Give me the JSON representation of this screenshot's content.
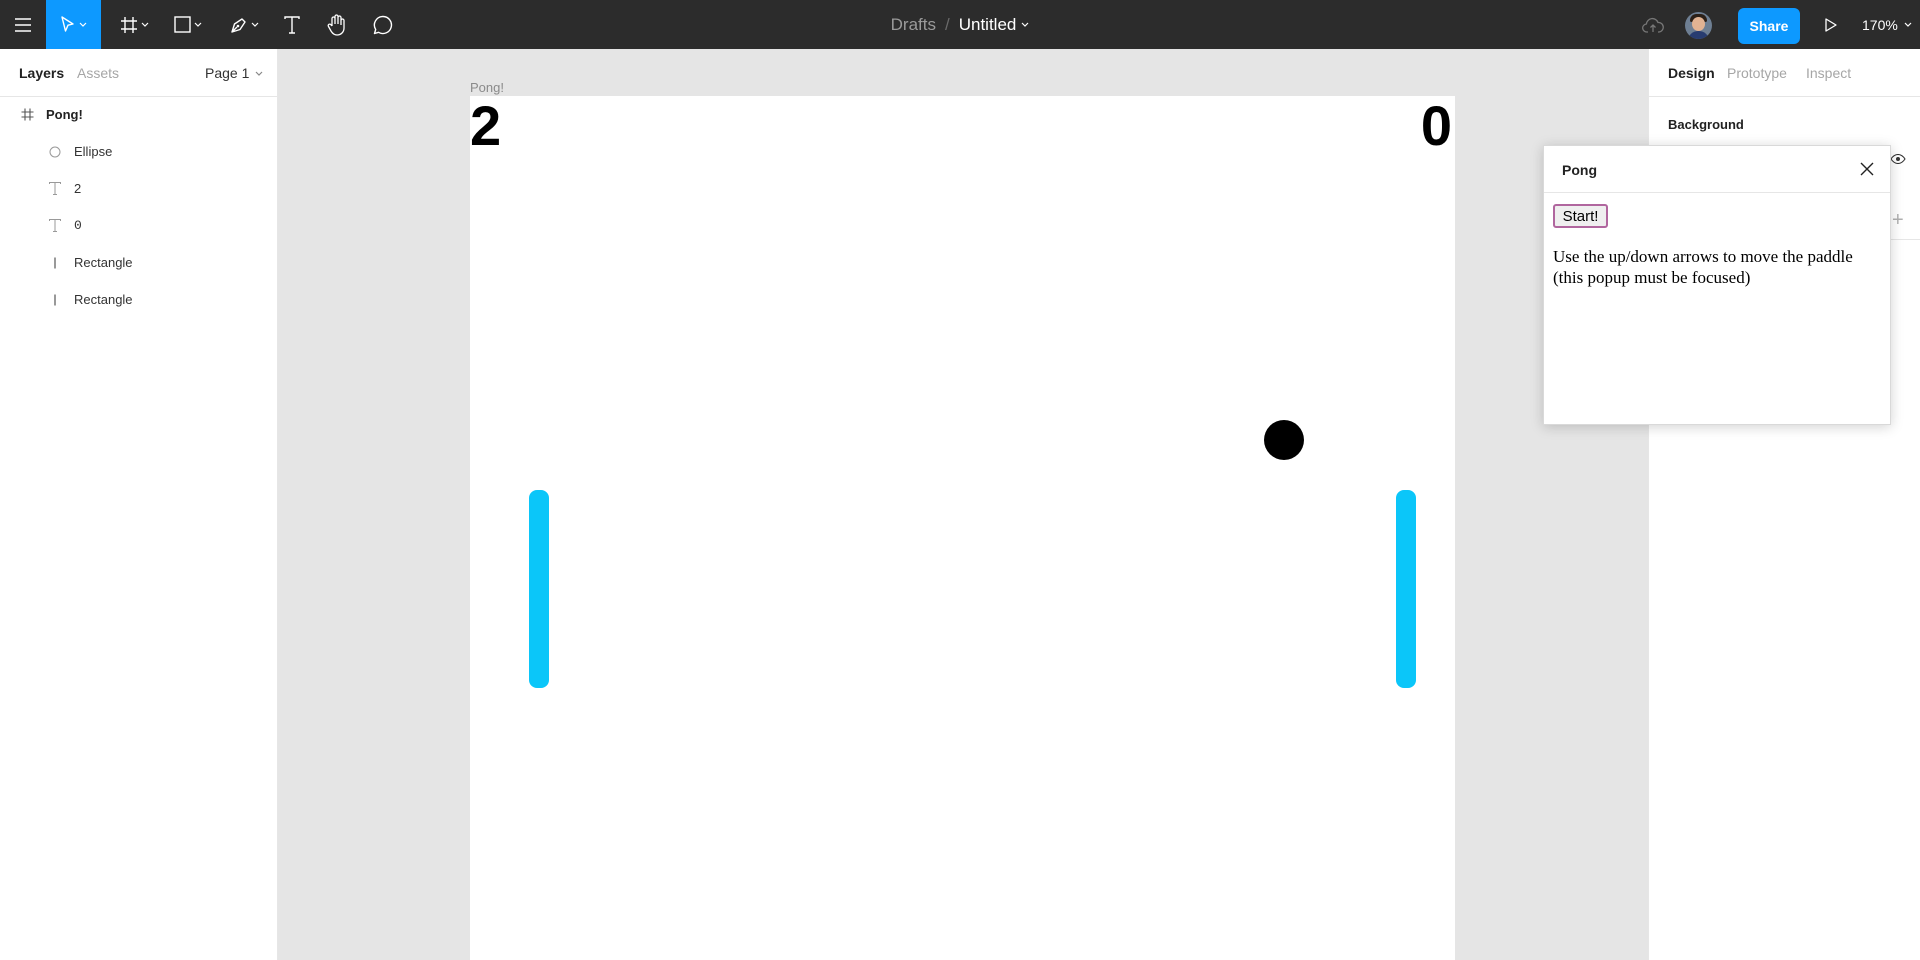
{
  "toolbar": {
    "breadcrumb_parent": "Drafts",
    "breadcrumb_separator": "/",
    "file_name": "Untitled",
    "share_label": "Share",
    "zoom_label": "170%",
    "accent_color": "#0d99ff",
    "tools": [
      "menu-icon",
      "move-tool-icon",
      "frame-tool-icon",
      "shape-tool-icon",
      "pen-tool-icon",
      "text-tool-icon",
      "hand-tool-icon",
      "comment-tool-icon"
    ]
  },
  "left_panel": {
    "tabs": {
      "layers": "Layers",
      "assets": "Assets"
    },
    "page_label": "Page 1",
    "layers": [
      {
        "name": "Pong!",
        "icon": "frame-icon"
      },
      {
        "name": "Ellipse",
        "icon": "ellipse-icon"
      },
      {
        "name": "2",
        "icon": "text-icon"
      },
      {
        "name": "0",
        "icon": "text-icon"
      },
      {
        "name": "Rectangle",
        "icon": "rectangle-icon"
      },
      {
        "name": "Rectangle",
        "icon": "rectangle-icon"
      }
    ]
  },
  "canvas": {
    "frame_label": "Pong!",
    "score_left": "2",
    "score_right": "0",
    "paddle_color": "#0bc6f9",
    "ball_color": "#000000"
  },
  "right_panel": {
    "tabs": {
      "design": "Design",
      "prototype": "Prototype",
      "inspect": "Inspect"
    },
    "background_heading": "Background"
  },
  "popup": {
    "title": "Pong",
    "start_label": "Start!",
    "instructions": "Use the up/down arrows to move the paddle (this popup must be focused)"
  }
}
